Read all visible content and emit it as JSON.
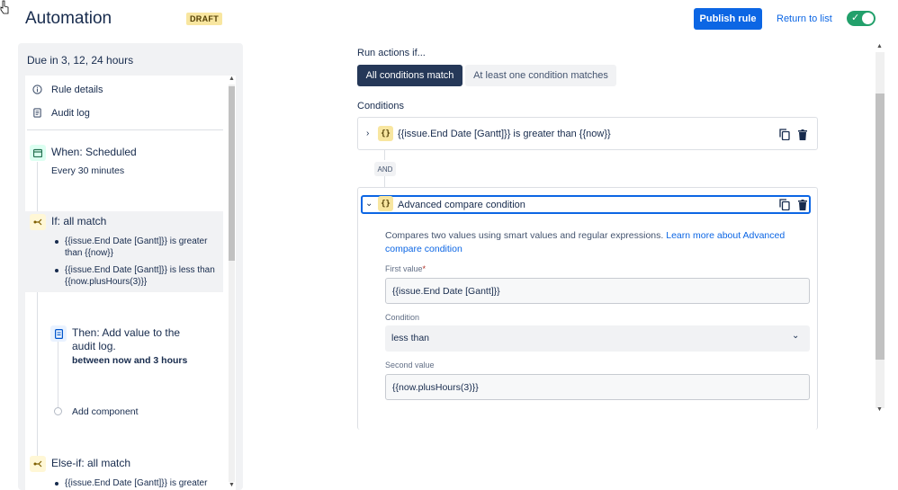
{
  "header": {
    "title": "Automation",
    "badge": "DRAFT",
    "publish_label": "Publish rule",
    "return_label": "Return to list",
    "toggle_enabled": true
  },
  "sidebar": {
    "title": "Due in 3, 12, 24 hours",
    "menu": [
      {
        "label": "Rule details",
        "icon": "info-icon"
      },
      {
        "label": "Audit log",
        "icon": "document-icon"
      }
    ],
    "trigger": {
      "title": "When: Scheduled",
      "subtitle": "Every 30 minutes",
      "icon": "calendar-icon"
    },
    "if_block": {
      "title": "If: all match",
      "icon": "branch-icon",
      "bullets": [
        {
          "line1": "{{issue.End Date [Gantt]}} is greater",
          "line2": "than {{now}}"
        },
        {
          "line1": "{{issue.End Date [Gantt]}} is less than",
          "line2": "{{now.plusHours(3)}}"
        }
      ]
    },
    "then_block": {
      "title_line1": "Then: Add value to the",
      "title_line2": "audit log.",
      "subtitle": "between now and 3 hours",
      "icon": "log-icon"
    },
    "add_component": "Add component",
    "else_block": {
      "title": "Else-if: all match",
      "icon": "branch-icon",
      "bullet": "{{issue.End Date [Gantt]}} is greater"
    }
  },
  "main": {
    "run_label": "Run actions if...",
    "seg_active": "All conditions match",
    "seg_inactive": "At least one condition matches",
    "conditions_label": "Conditions",
    "condition1": "{{issue.End Date [Gantt]}} is greater than {{now}}",
    "and_label": "AND",
    "condition2": {
      "title": "Advanced compare condition",
      "description": "Compares two values using smart values and regular expressions.",
      "link_part1": "Learn more about Advanced",
      "link_part2": "compare condition",
      "first_value_label": "First value",
      "required_mark": "*",
      "first_value": "{{issue.End Date [Gantt]}}",
      "condition_label": "Condition",
      "condition_value": "less than",
      "second_value_label": "Second value",
      "second_value": "{{now.plusHours(3)}}"
    }
  },
  "colors": {
    "primary": "#0c66e4",
    "toggle_on": "#22a06b",
    "badge_bg": "#f8e6a0",
    "segment_active": "#253858"
  }
}
